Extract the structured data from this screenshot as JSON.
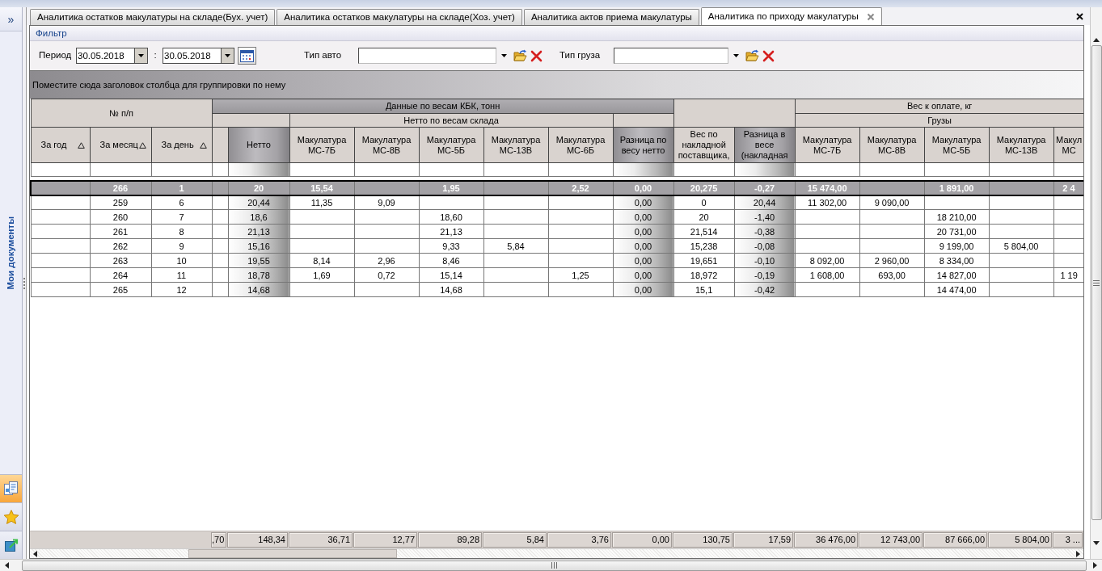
{
  "sidebar": {
    "toggle": "»",
    "title": "Мои документы",
    "tiles": [
      {
        "kind": "documents",
        "selected": true
      },
      {
        "kind": "favorites",
        "selected": false
      },
      {
        "kind": "shortcut",
        "selected": false
      }
    ]
  },
  "tabs": [
    {
      "label": "Аналитика остатков макулатуры на складе(Бух. учет)",
      "selected": false
    },
    {
      "label": "Аналитика остатков макулатуры на складе(Хоз. учет)",
      "selected": false
    },
    {
      "label": "Аналитика актов приема макулатуры",
      "selected": false
    },
    {
      "label": "Аналитика по приходу макулатуры",
      "selected": true
    }
  ],
  "filter": {
    "title": "Фильтр",
    "period": {
      "label": "Период",
      "from": "30.05.2018",
      "separator": ":",
      "to": "30.05.2018"
    },
    "lookups": [
      {
        "label": "Тип авто"
      },
      {
        "label": "Тип груза"
      }
    ]
  },
  "grid": {
    "group_panel": "Поместите сюда заголовок столбца для группировки по нему",
    "bands": [
      {
        "label": "№ п/п",
        "highlighted": false,
        "columns": [
          {
            "label": "За год",
            "sorted": true,
            "highlighted": false
          },
          {
            "label": "За месяц",
            "sorted": true,
            "highlighted": false
          },
          {
            "label": "За день",
            "sorted": true,
            "highlighted": false
          }
        ]
      },
      {
        "label": "Данные по весам КБК, тонн",
        "highlighted": true,
        "subgroups": [
          {
            "highlighted": false,
            "columns": [
              {
                "highlighted": false
              },
              {
                "label": "Нетто",
                "highlighted": true
              }
            ]
          },
          {
            "label": "Нетто по весам склада",
            "highlighted": false,
            "columns": [
              {
                "label": "Макулатура МС-7Б",
                "highlighted": false
              },
              {
                "label": "Макулатура МС-8В",
                "highlighted": false
              },
              {
                "label": "Макулатура МС-5Б",
                "highlighted": false
              },
              {
                "label": "Макулатура МС-13В",
                "highlighted": false
              },
              {
                "label": "Макулатура МС-6Б",
                "highlighted": false
              }
            ]
          },
          {
            "highlighted": false,
            "columns": [
              {
                "label": "Разница по весу нетто",
                "highlighted": true
              }
            ]
          }
        ]
      },
      {
        "highlighted": false,
        "columns": [
          {
            "label": "Вес по накладной поставщика,",
            "highlighted": false
          },
          {
            "label": "Разница в весе (накладная",
            "highlighted": true
          }
        ]
      },
      {
        "label": "Вес к оплате, кг",
        "highlighted": false,
        "subgroups": [
          {
            "label": "Грузы",
            "highlighted": false,
            "columns": [
              {
                "label": "Макулатура МС-7Б",
                "highlighted": false
              },
              {
                "label": "Макулатура МС-8В",
                "highlighted": false
              },
              {
                "label": "Макулатура МС-5Б",
                "highlighted": false
              },
              {
                "label": "Макулатура МС-13В",
                "highlighted": false
              },
              {
                "label": "Макул МС",
                "highlighted": false
              }
            ]
          }
        ]
      }
    ],
    "rows": [
      {
        "selected": true,
        "cells": [
          null,
          "266",
          "1",
          null,
          "20",
          "15,54",
          null,
          "1,95",
          null,
          "2,52",
          "0,00",
          "20,275",
          "-0,27",
          "15 474,00",
          null,
          "1 891,00",
          null,
          "2 4"
        ]
      },
      {
        "selected": false,
        "cells": [
          null,
          "259",
          "6",
          null,
          "20,44",
          "11,35",
          "9,09",
          null,
          null,
          null,
          "0,00",
          "0",
          "20,44",
          "11 302,00",
          "9 090,00",
          null,
          null,
          null
        ]
      },
      {
        "selected": false,
        "cells": [
          null,
          "260",
          "7",
          null,
          "18,6",
          null,
          null,
          "18,60",
          null,
          null,
          "0,00",
          "20",
          "-1,40",
          null,
          null,
          "18 210,00",
          null,
          null
        ]
      },
      {
        "selected": false,
        "cells": [
          null,
          "261",
          "8",
          null,
          "21,13",
          null,
          null,
          "21,13",
          null,
          null,
          "0,00",
          "21,514",
          "-0,38",
          null,
          null,
          "20 731,00",
          null,
          null
        ]
      },
      {
        "selected": false,
        "cells": [
          null,
          "262",
          "9",
          null,
          "15,16",
          null,
          null,
          "9,33",
          "5,84",
          null,
          "0,00",
          "15,238",
          "-0,08",
          null,
          null,
          "9 199,00",
          "5 804,00",
          null
        ]
      },
      {
        "selected": false,
        "cells": [
          null,
          "263",
          "10",
          null,
          "19,55",
          "8,14",
          "2,96",
          "8,46",
          null,
          null,
          "0,00",
          "19,651",
          "-0,10",
          "8 092,00",
          "2 960,00",
          "8 334,00",
          null,
          null
        ]
      },
      {
        "selected": false,
        "cells": [
          null,
          "264",
          "11",
          null,
          "18,78",
          "1,69",
          "0,72",
          "15,14",
          null,
          "1,25",
          "0,00",
          "18,972",
          "-0,19",
          "1 608,00",
          "693,00",
          "14 827,00",
          null,
          "1 19"
        ]
      },
      {
        "selected": false,
        "cells": [
          null,
          "265",
          "12",
          null,
          "14,68",
          null,
          null,
          "14,68",
          null,
          null,
          "0,00",
          "15,1",
          "-0,42",
          null,
          null,
          "14 474,00",
          null,
          null
        ]
      }
    ],
    "footer": [
      ",70",
      "148,34",
      "36,71",
      "12,77",
      "89,28",
      "5,84",
      "3,76",
      "0,00",
      "130,75",
      "17,59",
      "36 476,00",
      "12 743,00",
      "87 666,00",
      "5 804,00",
      "3 ..."
    ]
  }
}
